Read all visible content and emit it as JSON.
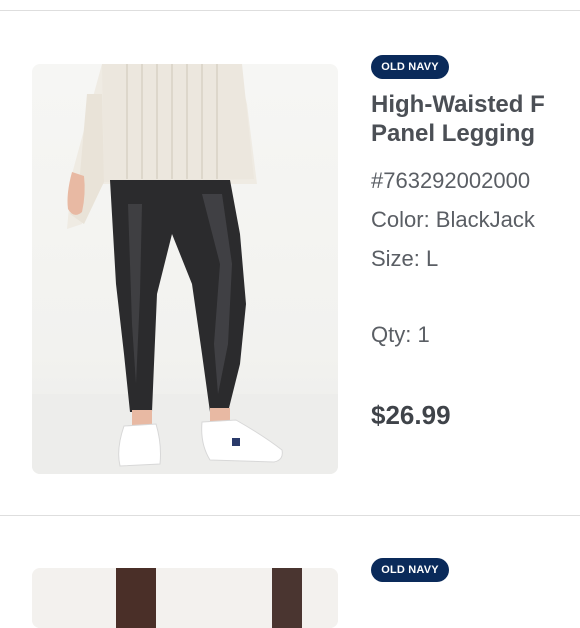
{
  "items": [
    {
      "brand": "OLD NAVY",
      "title_line1": "High-Waisted F",
      "title_line2": "Panel Legging",
      "sku": "#763292002000",
      "color": "Color: BlackJack",
      "size": "Size: L",
      "qty": "Qty: 1",
      "price": "$26.99",
      "image_icon": "leggings-product-photo"
    },
    {
      "brand": "OLD NAVY",
      "image_icon": "product-photo"
    }
  ]
}
